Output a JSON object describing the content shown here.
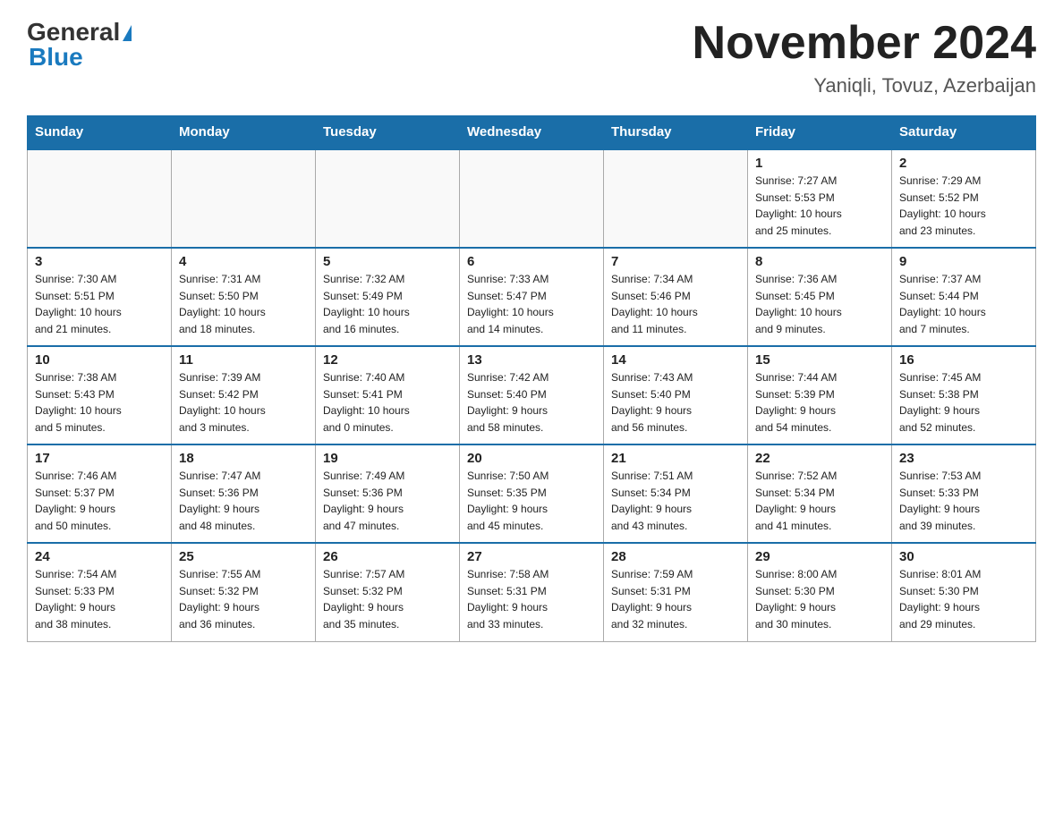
{
  "header": {
    "logo_general": "General",
    "logo_blue": "Blue",
    "month_title": "November 2024",
    "location": "Yaniqli, Tovuz, Azerbaijan"
  },
  "days_of_week": [
    "Sunday",
    "Monday",
    "Tuesday",
    "Wednesday",
    "Thursday",
    "Friday",
    "Saturday"
  ],
  "weeks": [
    [
      {
        "day": "",
        "info": ""
      },
      {
        "day": "",
        "info": ""
      },
      {
        "day": "",
        "info": ""
      },
      {
        "day": "",
        "info": ""
      },
      {
        "day": "",
        "info": ""
      },
      {
        "day": "1",
        "info": "Sunrise: 7:27 AM\nSunset: 5:53 PM\nDaylight: 10 hours\nand 25 minutes."
      },
      {
        "day": "2",
        "info": "Sunrise: 7:29 AM\nSunset: 5:52 PM\nDaylight: 10 hours\nand 23 minutes."
      }
    ],
    [
      {
        "day": "3",
        "info": "Sunrise: 7:30 AM\nSunset: 5:51 PM\nDaylight: 10 hours\nand 21 minutes."
      },
      {
        "day": "4",
        "info": "Sunrise: 7:31 AM\nSunset: 5:50 PM\nDaylight: 10 hours\nand 18 minutes."
      },
      {
        "day": "5",
        "info": "Sunrise: 7:32 AM\nSunset: 5:49 PM\nDaylight: 10 hours\nand 16 minutes."
      },
      {
        "day": "6",
        "info": "Sunrise: 7:33 AM\nSunset: 5:47 PM\nDaylight: 10 hours\nand 14 minutes."
      },
      {
        "day": "7",
        "info": "Sunrise: 7:34 AM\nSunset: 5:46 PM\nDaylight: 10 hours\nand 11 minutes."
      },
      {
        "day": "8",
        "info": "Sunrise: 7:36 AM\nSunset: 5:45 PM\nDaylight: 10 hours\nand 9 minutes."
      },
      {
        "day": "9",
        "info": "Sunrise: 7:37 AM\nSunset: 5:44 PM\nDaylight: 10 hours\nand 7 minutes."
      }
    ],
    [
      {
        "day": "10",
        "info": "Sunrise: 7:38 AM\nSunset: 5:43 PM\nDaylight: 10 hours\nand 5 minutes."
      },
      {
        "day": "11",
        "info": "Sunrise: 7:39 AM\nSunset: 5:42 PM\nDaylight: 10 hours\nand 3 minutes."
      },
      {
        "day": "12",
        "info": "Sunrise: 7:40 AM\nSunset: 5:41 PM\nDaylight: 10 hours\nand 0 minutes."
      },
      {
        "day": "13",
        "info": "Sunrise: 7:42 AM\nSunset: 5:40 PM\nDaylight: 9 hours\nand 58 minutes."
      },
      {
        "day": "14",
        "info": "Sunrise: 7:43 AM\nSunset: 5:40 PM\nDaylight: 9 hours\nand 56 minutes."
      },
      {
        "day": "15",
        "info": "Sunrise: 7:44 AM\nSunset: 5:39 PM\nDaylight: 9 hours\nand 54 minutes."
      },
      {
        "day": "16",
        "info": "Sunrise: 7:45 AM\nSunset: 5:38 PM\nDaylight: 9 hours\nand 52 minutes."
      }
    ],
    [
      {
        "day": "17",
        "info": "Sunrise: 7:46 AM\nSunset: 5:37 PM\nDaylight: 9 hours\nand 50 minutes."
      },
      {
        "day": "18",
        "info": "Sunrise: 7:47 AM\nSunset: 5:36 PM\nDaylight: 9 hours\nand 48 minutes."
      },
      {
        "day": "19",
        "info": "Sunrise: 7:49 AM\nSunset: 5:36 PM\nDaylight: 9 hours\nand 47 minutes."
      },
      {
        "day": "20",
        "info": "Sunrise: 7:50 AM\nSunset: 5:35 PM\nDaylight: 9 hours\nand 45 minutes."
      },
      {
        "day": "21",
        "info": "Sunrise: 7:51 AM\nSunset: 5:34 PM\nDaylight: 9 hours\nand 43 minutes."
      },
      {
        "day": "22",
        "info": "Sunrise: 7:52 AM\nSunset: 5:34 PM\nDaylight: 9 hours\nand 41 minutes."
      },
      {
        "day": "23",
        "info": "Sunrise: 7:53 AM\nSunset: 5:33 PM\nDaylight: 9 hours\nand 39 minutes."
      }
    ],
    [
      {
        "day": "24",
        "info": "Sunrise: 7:54 AM\nSunset: 5:33 PM\nDaylight: 9 hours\nand 38 minutes."
      },
      {
        "day": "25",
        "info": "Sunrise: 7:55 AM\nSunset: 5:32 PM\nDaylight: 9 hours\nand 36 minutes."
      },
      {
        "day": "26",
        "info": "Sunrise: 7:57 AM\nSunset: 5:32 PM\nDaylight: 9 hours\nand 35 minutes."
      },
      {
        "day": "27",
        "info": "Sunrise: 7:58 AM\nSunset: 5:31 PM\nDaylight: 9 hours\nand 33 minutes."
      },
      {
        "day": "28",
        "info": "Sunrise: 7:59 AM\nSunset: 5:31 PM\nDaylight: 9 hours\nand 32 minutes."
      },
      {
        "day": "29",
        "info": "Sunrise: 8:00 AM\nSunset: 5:30 PM\nDaylight: 9 hours\nand 30 minutes."
      },
      {
        "day": "30",
        "info": "Sunrise: 8:01 AM\nSunset: 5:30 PM\nDaylight: 9 hours\nand 29 minutes."
      }
    ]
  ]
}
